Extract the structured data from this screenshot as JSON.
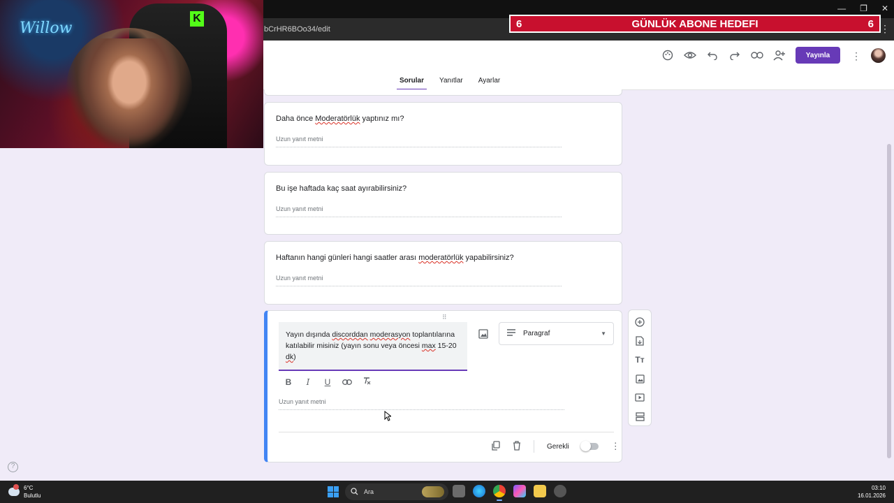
{
  "browser": {
    "url": "bCrHR6BOo34/edit",
    "window_controls": [
      "—",
      "❐",
      "✕"
    ]
  },
  "stream_overlay": {
    "goal_title": "GÜNLÜK ABONE HEDEFI",
    "current": "6",
    "target": "6"
  },
  "header": {
    "publish_label": "Yayınla",
    "tabs": [
      {
        "label": "Sorular",
        "active": true
      },
      {
        "label": "Yanıtlar",
        "active": false
      },
      {
        "label": "Ayarlar",
        "active": false
      }
    ],
    "tool_icons": [
      "palette-icon",
      "preview-eye-icon",
      "undo-icon",
      "redo-icon",
      "link-icon",
      "add-collaborator-icon"
    ]
  },
  "questions": [
    {
      "title_before": "Daha önce ",
      "title_spell": "Moderatörlük",
      "title_after": " yaptınız mı?",
      "answer_placeholder": "Uzun yanıt metni"
    },
    {
      "title": "Bu işe haftada kaç saat ayırabilirsiniz?",
      "answer_placeholder": "Uzun yanıt metni"
    },
    {
      "title_before": "Haftanın hangi günleri hangi saatler arası ",
      "title_spell": "moderatörlük",
      "title_after": " yapabilirsiniz?",
      "answer_placeholder": "Uzun yanıt metni"
    }
  ],
  "active_question": {
    "p1": "Yayın dışında ",
    "s1": "discorddan",
    "p2": " ",
    "s2": "moderasyon",
    "p3": " toplantılarına katılabilir misiniz (yayın sonu veya öncesi ",
    "s3": "max",
    "p4": " 15-20 ",
    "s4": "dk",
    "p5": ")",
    "type_label": "Paragraf",
    "answer_placeholder": "Uzun yanıt metni",
    "required_label": "Gerekli",
    "required": false
  },
  "taskbar": {
    "temperature": "6°C",
    "weather": "Bulutlu",
    "search_placeholder": "Ara",
    "time": "03:10",
    "date": "16.01.2026"
  }
}
